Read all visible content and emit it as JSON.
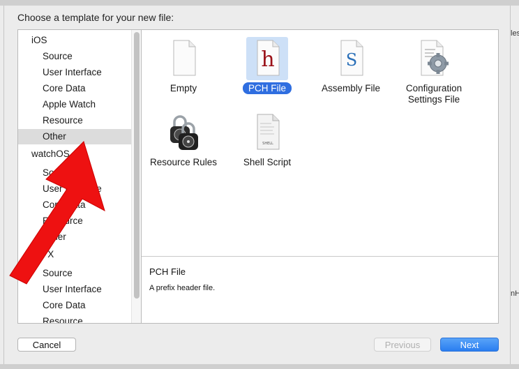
{
  "dialog": {
    "title": "Choose a template for your new file:"
  },
  "sidebar": {
    "items": [
      {
        "label": "iOS",
        "kind": "header"
      },
      {
        "label": "Source",
        "kind": "sub"
      },
      {
        "label": "User Interface",
        "kind": "sub"
      },
      {
        "label": "Core Data",
        "kind": "sub"
      },
      {
        "label": "Apple Watch",
        "kind": "sub"
      },
      {
        "label": "Resource",
        "kind": "sub"
      },
      {
        "label": "Other",
        "kind": "sub",
        "selected": true
      },
      {
        "label": "watchOS",
        "kind": "header"
      },
      {
        "label": "Source",
        "kind": "sub"
      },
      {
        "label": "User Interface",
        "kind": "sub"
      },
      {
        "label": "Core Data",
        "kind": "sub"
      },
      {
        "label": "Resource",
        "kind": "sub"
      },
      {
        "label": "Other",
        "kind": "sub"
      },
      {
        "label": "OS X",
        "kind": "header"
      },
      {
        "label": "Source",
        "kind": "sub"
      },
      {
        "label": "User Interface",
        "kind": "sub"
      },
      {
        "label": "Core Data",
        "kind": "sub"
      },
      {
        "label": "Resource",
        "kind": "sub"
      }
    ]
  },
  "templates": [
    {
      "label": "Empty",
      "icon": "empty-file-icon"
    },
    {
      "label": "PCH File",
      "icon": "pch-file-icon",
      "glyph": "h",
      "selected": true
    },
    {
      "label": "Assembly File",
      "icon": "assembly-file-icon",
      "glyph": "S"
    },
    {
      "label": "Configuration Settings File",
      "line1": "Configuration",
      "line2": "Settings File",
      "icon": "configuration-settings-icon"
    },
    {
      "label": "Resource Rules",
      "icon": "padlocks-icon"
    },
    {
      "label": "Shell Script",
      "icon": "shell-script-icon",
      "glyph": "SHELL"
    }
  ],
  "description": {
    "title": "PCH File",
    "text": "A prefix header file."
  },
  "buttons": {
    "cancel": "Cancel",
    "previous": "Previous",
    "next": "Next"
  },
  "background": {
    "right_fragments": [
      "les",
      "nH"
    ]
  },
  "colors": {
    "selection": "#2f6ee0",
    "accent_next": "#2a7ef0",
    "annotation_arrow": "#ee1111"
  }
}
